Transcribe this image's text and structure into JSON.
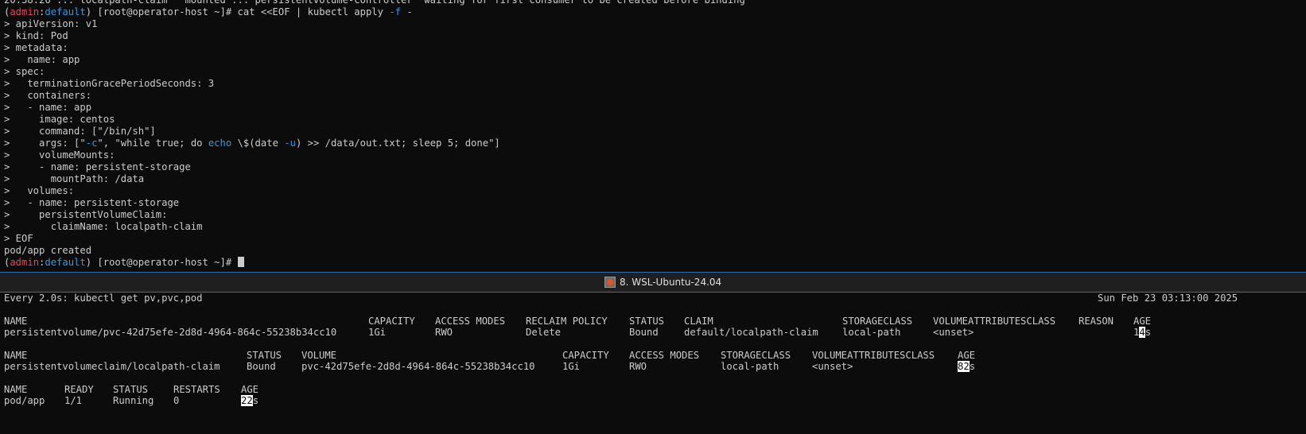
{
  "top_terminal": {
    "prev_line": "20:38:26 ... localpath-claim   mounted ... persistentvolume-controller  waiting for first consumer to be created before binding",
    "prompt_open": "(",
    "prompt_user": "admin",
    "prompt_colon": ":",
    "prompt_context": "default",
    "prompt_rest": ") [root@operator-host ~]# ",
    "command_a": "cat <<EOF | kubectl apply ",
    "command_flag": "-f",
    "command_b": " -",
    "yaml_lines": [
      "> apiVersion: v1",
      "> kind: Pod",
      "> metadata:",
      ">   name: app",
      "> spec:",
      ">   terminationGracePeriodSeconds: 3",
      ">   containers:",
      ">   - name: app",
      ">     image: centos",
      ">     command: [\"/bin/sh\"]"
    ],
    "args_a": ">     args: [\"",
    "args_flag_c": "-c",
    "args_b": "\", \"while true; do ",
    "args_echo": "echo",
    "args_c": " \\$(date ",
    "args_flag_u": "-u",
    "args_d": ") >> /data/out.txt; sleep 5; done\"]",
    "yaml_lines_2": [
      ">     volumeMounts:",
      ">     - name: persistent-storage",
      ">       mountPath: /data",
      ">   volumes:",
      ">   - name: persistent-storage",
      ">     persistentVolumeClaim:",
      ">       claimName: localpath-claim",
      "> EOF"
    ],
    "result": "pod/app created"
  },
  "tab": {
    "icon": "ubuntu-icon",
    "label": "8. WSL-Ubuntu-24.04"
  },
  "watch": {
    "header": "Every 2.0s: kubectl get pv,pvc,pod",
    "datetime": "Sun Feb 23 03:13:00 2025",
    "pv": {
      "headers": [
        "NAME",
        "CAPACITY",
        "ACCESS MODES",
        "RECLAIM POLICY",
        "STATUS",
        "CLAIM",
        "STORAGECLASS",
        "VOLUMEATTRIBUTESCLASS",
        "REASON",
        "AGE"
      ],
      "row": [
        "persistentvolume/pvc-42d75efe-2d8d-4964-864c-55238b34cc10",
        "1Gi",
        "RWO",
        "Delete",
        "Bound",
        "default/localpath-claim",
        "local-path",
        "<unset>",
        "",
        "14s"
      ],
      "age_pre": "1",
      "age_hl": "4",
      "age_post": "s"
    },
    "pvc": {
      "headers": [
        "NAME",
        "STATUS",
        "VOLUME",
        "CAPACITY",
        "ACCESS MODES",
        "STORAGECLASS",
        "VOLUMEATTRIBUTESCLASS",
        "AGE"
      ],
      "row": [
        "persistentvolumeclaim/localpath-claim",
        "Bound",
        "pvc-42d75efe-2d8d-4964-864c-55238b34cc10",
        "1Gi",
        "RWO",
        "local-path",
        "<unset>",
        "82s"
      ],
      "age_hl": "82",
      "age_post": "s"
    },
    "pod": {
      "headers": [
        "NAME",
        "READY",
        "STATUS",
        "RESTARTS",
        "AGE"
      ],
      "row": [
        "pod/app",
        "1/1",
        "Running",
        "0",
        "22s"
      ],
      "age_hl": "22",
      "age_post": "s"
    }
  },
  "colors": {
    "background": "#0c0c0c",
    "foreground": "#cccccc",
    "prompt_user": "#e74856",
    "prompt_context": "#3a96dd",
    "flag": "#3a96dd",
    "pane_border": "#2b6cb0"
  }
}
